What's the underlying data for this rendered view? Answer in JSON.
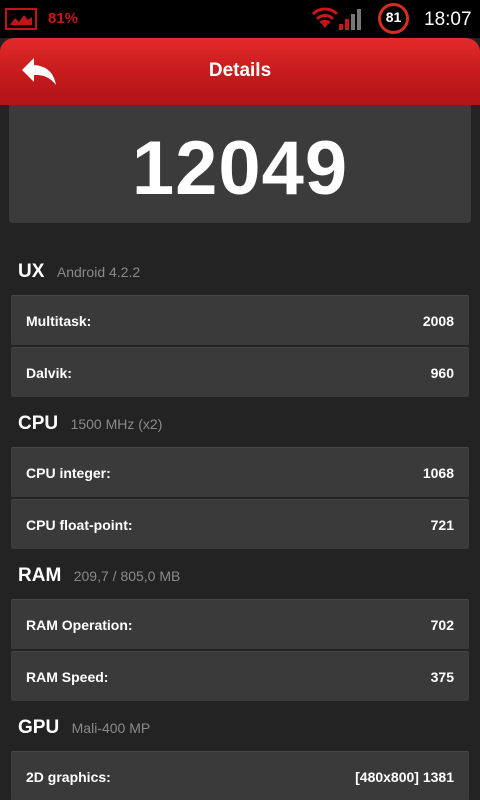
{
  "status_bar": {
    "battery_percent": "81%",
    "monitor_value": "81",
    "time": "18:07",
    "icons": [
      "gallery-icon",
      "wifi-icon",
      "signal-icon"
    ],
    "accent_color": "#c8161c"
  },
  "header": {
    "title": "Details",
    "back_icon": "back-arrow-icon",
    "color": "#c41a1c"
  },
  "score": "12049",
  "sections": [
    {
      "title": "UX",
      "subtitle": "Android 4.2.2",
      "rows": [
        {
          "label": "Multitask:",
          "value": "2008"
        },
        {
          "label": "Dalvik:",
          "value": "960"
        }
      ]
    },
    {
      "title": "CPU",
      "subtitle": "1500 MHz (x2)",
      "rows": [
        {
          "label": "CPU integer:",
          "value": "1068"
        },
        {
          "label": "CPU float-point:",
          "value": "721"
        }
      ]
    },
    {
      "title": "RAM",
      "subtitle": "209,7 / 805,0 MB",
      "rows": [
        {
          "label": "RAM Operation:",
          "value": "702"
        },
        {
          "label": "RAM Speed:",
          "value": "375"
        }
      ]
    },
    {
      "title": "GPU",
      "subtitle": "Mali-400 MP",
      "rows": [
        {
          "label": "2D graphics:",
          "value": "[480x800] 1381"
        }
      ]
    }
  ]
}
